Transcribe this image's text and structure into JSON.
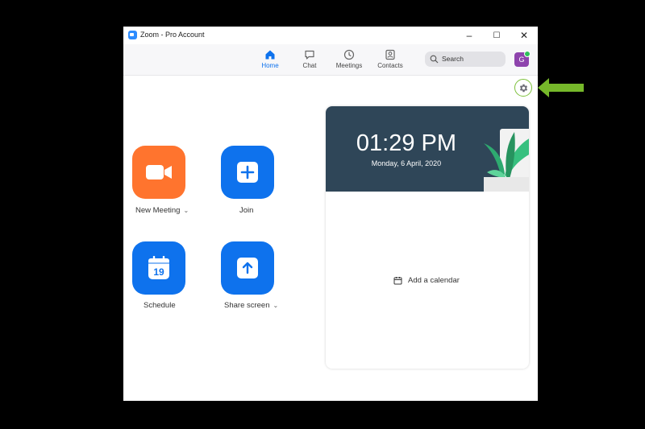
{
  "window": {
    "title": "Zoom - Pro Account",
    "controls": {
      "minimize": "–",
      "maximize": "☐",
      "close": "✕"
    }
  },
  "nav": {
    "tabs": [
      {
        "label": "Home",
        "icon": "home-icon",
        "active": true
      },
      {
        "label": "Chat",
        "icon": "chat-icon",
        "active": false
      },
      {
        "label": "Meetings",
        "icon": "clock-icon",
        "active": false
      },
      {
        "label": "Contacts",
        "icon": "contacts-icon",
        "active": false
      }
    ],
    "search_label": "Search",
    "avatar_initial": "G",
    "avatar_status": "online"
  },
  "actions": [
    {
      "label": "New Meeting",
      "icon": "video-camera-icon",
      "color": "#FF742E",
      "has_dropdown": true
    },
    {
      "label": "Join",
      "icon": "plus-icon",
      "color": "#0E72ED",
      "has_dropdown": false
    },
    {
      "label": "Schedule",
      "icon": "calendar-icon",
      "color": "#0E72ED",
      "has_dropdown": false,
      "icon_text": "19"
    },
    {
      "label": "Share screen",
      "icon": "share-screen-icon",
      "color": "#0E72ED",
      "has_dropdown": true
    }
  ],
  "calendar_card": {
    "time": "01:29 PM",
    "date": "Monday, 6 April, 2020",
    "add_calendar_label": "Add a calendar"
  },
  "colors": {
    "accent": "#0E72ED",
    "orange": "#FF742E",
    "avatar": "#8E44AD",
    "highlight_arrow": "#76B82A"
  }
}
